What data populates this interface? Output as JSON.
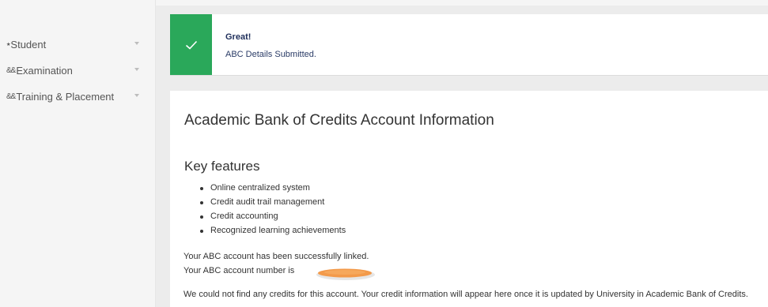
{
  "sidebar": {
    "items": [
      {
        "icon": "user-icon",
        "label": "Student"
      },
      {
        "icon": "users-icon",
        "label": "Examination"
      },
      {
        "icon": "users-icon",
        "label": "Training & Placement"
      }
    ]
  },
  "alert": {
    "icon": "check-icon",
    "title": "Great!",
    "message": "ABC Details Submitted.",
    "color": "#2aa85a"
  },
  "content": {
    "heading": "Academic Bank of Credits Account Information",
    "features_title": "Key features",
    "features": [
      "Online centralized system",
      "Credit audit trail management",
      "Credit accounting",
      "Recognized learning achievements"
    ],
    "linked_text": "Your ABC account has been successfully linked.",
    "account_number_text": "Your ABC account number is",
    "no_credits_text": "We could not find any credits for this account. Your credit information will appear here once it is updated by University in Academic Bank of Credits."
  }
}
